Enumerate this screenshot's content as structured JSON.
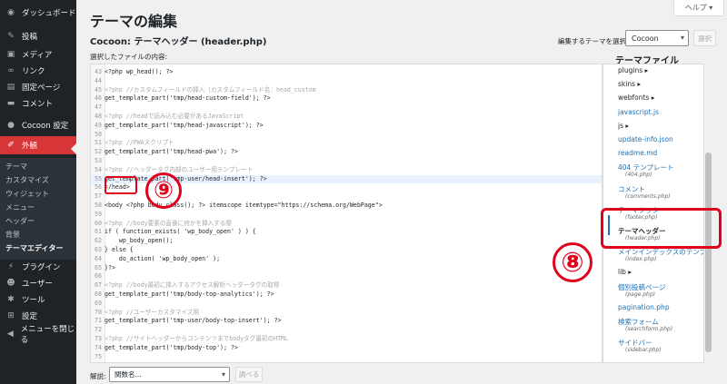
{
  "sidebar": {
    "items": [
      {
        "label": "ダッシュボード",
        "icon": "dashboard-icon",
        "glyph": "◉"
      },
      {
        "label": "投稿",
        "icon": "pin-icon",
        "glyph": "✎"
      },
      {
        "label": "メディア",
        "icon": "media-icon",
        "glyph": "▣"
      },
      {
        "label": "リンク",
        "icon": "link-icon",
        "glyph": "∞"
      },
      {
        "label": "固定ページ",
        "icon": "page-icon",
        "glyph": "▤"
      },
      {
        "label": "コメント",
        "icon": "comment-icon",
        "glyph": "▬"
      },
      {
        "label": "Cocoon 設定",
        "icon": "cocoon-icon",
        "glyph": "●"
      },
      {
        "label": "外観",
        "icon": "appearance-icon",
        "glyph": "✐"
      },
      {
        "label": "プラグイン",
        "icon": "plugin-icon",
        "glyph": "⚡"
      },
      {
        "label": "ユーザー",
        "icon": "user-icon",
        "glyph": "☻"
      },
      {
        "label": "ツール",
        "icon": "tools-icon",
        "glyph": "✱"
      },
      {
        "label": "設定",
        "icon": "settings-icon",
        "glyph": "⊞"
      },
      {
        "label": "メニューを閉じる",
        "icon": "collapse-icon",
        "glyph": "◀"
      }
    ],
    "submenu": [
      "テーマ",
      "カスタマイズ",
      "ウィジェット",
      "メニュー",
      "ヘッダー",
      "背景",
      "テーマエディター"
    ]
  },
  "header": {
    "help": "ヘルプ ▾",
    "title": "テーマの編集",
    "file_heading": "Cocoon: テーマヘッダー (header.php)",
    "select_label": "編集するテーマを選択:",
    "theme_value": "Cocoon",
    "select_button": "選択",
    "content_label": "選択したファイルの内容:",
    "files_heading": "テーマファイル"
  },
  "code_lines": [
    {
      "n": "43",
      "t": "<?php wp_head(); ?>",
      "c": false
    },
    {
      "n": "44",
      "t": "",
      "c": false
    },
    {
      "n": "45",
      "t": "<?php //カスタムフィールドの挿入（カスタムフィールド名：head_custom",
      "c": true
    },
    {
      "n": "46",
      "t": "get_template_part('tmp/head-custom-field'); ?>",
      "c": false
    },
    {
      "n": "47",
      "t": "",
      "c": false
    },
    {
      "n": "48",
      "t": "<?php //headで読み込む必要があるJavaScript",
      "c": true
    },
    {
      "n": "49",
      "t": "get_template_part('tmp/head-javascript'); ?>",
      "c": false
    },
    {
      "n": "50",
      "t": "",
      "c": false
    },
    {
      "n": "51",
      "t": "<?php //PWAスクリプト",
      "c": true
    },
    {
      "n": "52",
      "t": "get_template_part('tmp/head-pwa'); ?>",
      "c": false
    },
    {
      "n": "53",
      "t": "",
      "c": false
    },
    {
      "n": "54",
      "t": "<?php //ヘッダータグ内部のユーザー用テンプレート",
      "c": true
    },
    {
      "n": "55",
      "t": "get_template_part('tmp-user/head-insert'); ?>",
      "c": false
    },
    {
      "n": "56",
      "t": "</head>",
      "c": false
    },
    {
      "n": "57",
      "t": "",
      "c": false
    },
    {
      "n": "58",
      "t": "<body <?php body_class(); ?> itemscope itemtype=\"https://schema.org/WebPage\">",
      "c": false
    },
    {
      "n": "59",
      "t": "",
      "c": false
    },
    {
      "n": "60",
      "t": "<?php //body要素の直後に何かを挿入する際",
      "c": true
    },
    {
      "n": "61",
      "t": "if ( function_exists( 'wp_body_open' ) ) {",
      "c": false
    },
    {
      "n": "62",
      "t": "    wp_body_open();",
      "c": false
    },
    {
      "n": "63",
      "t": "} else {",
      "c": false
    },
    {
      "n": "64",
      "t": "    do_action( 'wp_body_open' );",
      "c": false
    },
    {
      "n": "65",
      "t": "}?>",
      "c": false
    },
    {
      "n": "66",
      "t": "",
      "c": false
    },
    {
      "n": "67",
      "t": "<?php //body最初に挿入するアクセス解析ヘッダータグの取得",
      "c": true
    },
    {
      "n": "68",
      "t": "get_template_part('tmp/body-top-analytics'); ?>",
      "c": false
    },
    {
      "n": "69",
      "t": "",
      "c": false
    },
    {
      "n": "70",
      "t": "<?php //ユーザーカスタマイズ用",
      "c": true
    },
    {
      "n": "71",
      "t": "get_template_part('tmp-user/body-top-insert'); ?>",
      "c": false
    },
    {
      "n": "72",
      "t": "",
      "c": false
    },
    {
      "n": "73",
      "t": "<?php //サイトヘッダーからコンテンツまでbodyタグ最初のHTML",
      "c": true
    },
    {
      "n": "74",
      "t": "get_template_part('tmp/body-top'); ?>",
      "c": false
    },
    {
      "n": "75",
      "t": "",
      "c": false
    }
  ],
  "files": [
    {
      "name": "plugins ▸",
      "sub": "",
      "type": "folder"
    },
    {
      "name": "skins ▸",
      "sub": "",
      "type": "folder"
    },
    {
      "name": "webfonts ▸",
      "sub": "",
      "type": "folder"
    },
    {
      "name": "javascript.js",
      "sub": "",
      "type": "file"
    },
    {
      "name": "js ▸",
      "sub": "",
      "type": "folder"
    },
    {
      "name": "update-info.json",
      "sub": "",
      "type": "file"
    },
    {
      "name": "readme.md",
      "sub": "",
      "type": "file"
    },
    {
      "name": "404 テンプレート",
      "sub": "(404.php)",
      "type": "file"
    },
    {
      "name": "コメント",
      "sub": "(comments.php)",
      "type": "file"
    },
    {
      "name": "テーマフッター",
      "sub": "(footer.php)",
      "type": "file"
    },
    {
      "name": "テーマヘッダー",
      "sub": "(header.php)",
      "type": "current"
    },
    {
      "name": "メインインデックスのテンプ",
      "sub": "(index.php)",
      "type": "file"
    },
    {
      "name": "lib ▸",
      "sub": "",
      "type": "folder"
    },
    {
      "name": "個別投稿ページ",
      "sub": "(page.php)",
      "type": "file"
    },
    {
      "name": "pagination.php",
      "sub": "",
      "type": "file"
    },
    {
      "name": "検索フォーム",
      "sub": "(searchform.php)",
      "type": "file"
    },
    {
      "name": "サイドバー",
      "sub": "(sidebar.php)",
      "type": "file"
    }
  ],
  "footer": {
    "doc_label": "解説:",
    "doc_value": "関数名...",
    "lookup_button": "調べる"
  },
  "annotations": {
    "circle_9": "⑨",
    "circle_8": "⑧"
  },
  "colors": {
    "accent": "#2271b1",
    "sidebar_bg": "#1d2327",
    "active": "#d63638",
    "annotation": "#e0001b"
  }
}
